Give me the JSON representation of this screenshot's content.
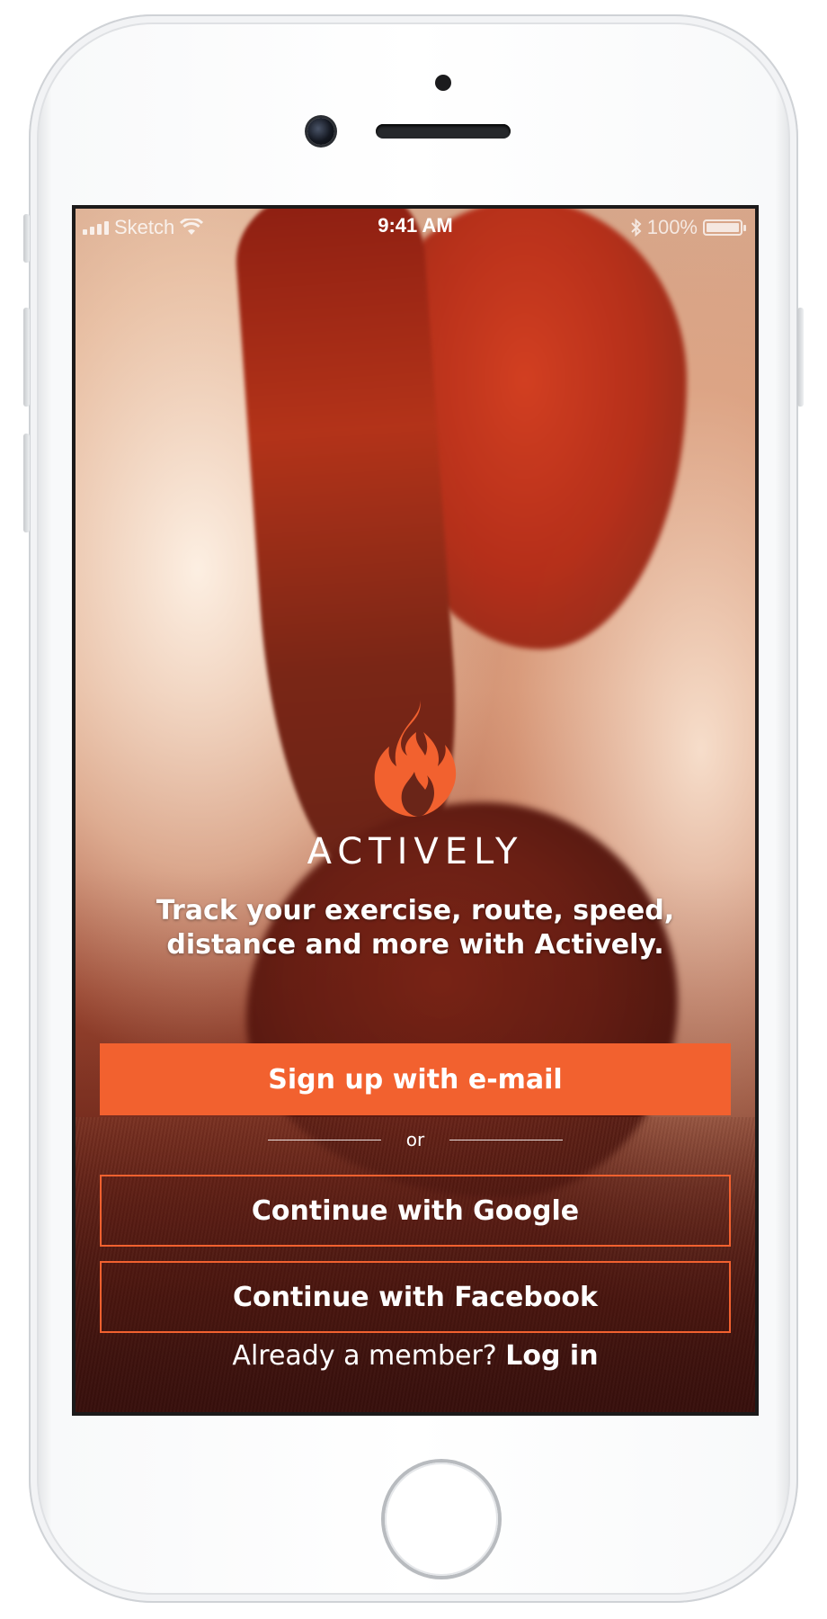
{
  "status_bar": {
    "carrier": "Sketch",
    "time": "9:41 AM",
    "battery": "100%"
  },
  "brand": {
    "name": "ACTIVELY",
    "logo_icon": "flame-icon",
    "accent_color": "#f2612f"
  },
  "tagline": "Track your exercise, route, speed, distance and more with Actively.",
  "buttons": {
    "signup_email": "Sign up with e-mail",
    "divider": "or",
    "google": "Continue with Google",
    "facebook": "Continue with Facebook"
  },
  "footer": {
    "prompt": "Already a member?",
    "login": "Log in"
  }
}
